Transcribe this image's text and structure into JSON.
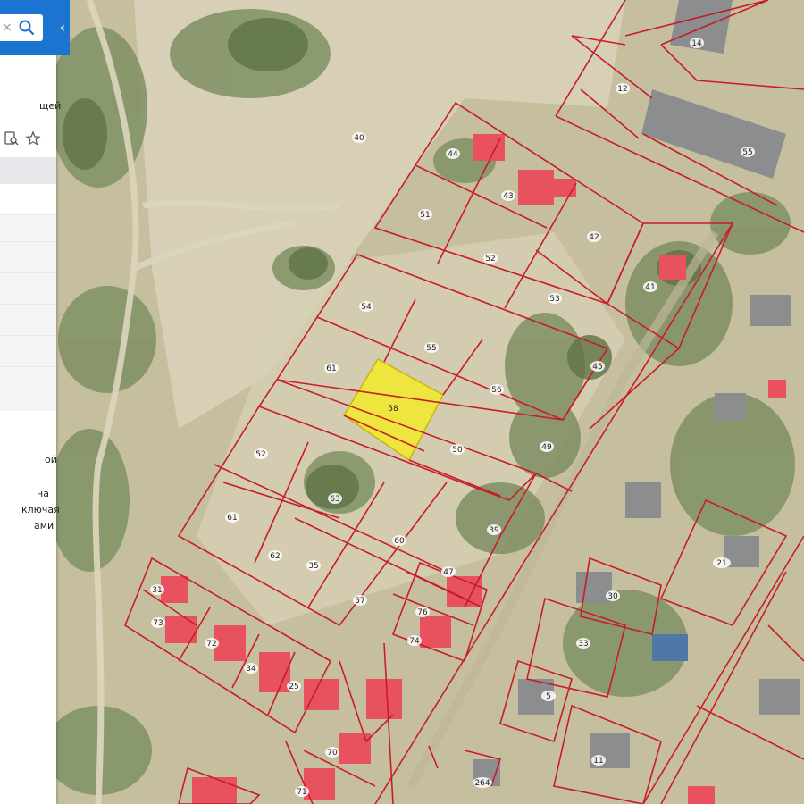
{
  "panel": {
    "search_clear": "×",
    "collapse_symbol": "‹",
    "line_top": "щей",
    "line_1": "ой",
    "line_2": "на",
    "line_3": "ключая",
    "line_4": "ами"
  },
  "icons": [
    "close-icon",
    "search-icon",
    "chevron-left-icon",
    "document-search-icon",
    "star-icon"
  ],
  "colors": {
    "boundary": "#c81c28",
    "selected_fill": "#f2ea2a",
    "roof": "#e8525e",
    "panel_header": "#1b75d0"
  },
  "map": {
    "selected_parcel": "58",
    "parcel_labels": [
      "14",
      "12",
      "40",
      "44",
      "43",
      "42",
      "51",
      "52",
      "53",
      "41",
      "54",
      "55",
      "61",
      "58",
      "56",
      "45",
      "52",
      "50",
      "49",
      "63",
      "61",
      "62",
      "60",
      "39",
      "35",
      "57",
      "47",
      "31",
      "72",
      "34",
      "73",
      "74",
      "76",
      "25",
      "30",
      "5",
      "33",
      "11",
      "55",
      "21",
      "70",
      "71",
      "264"
    ]
  }
}
